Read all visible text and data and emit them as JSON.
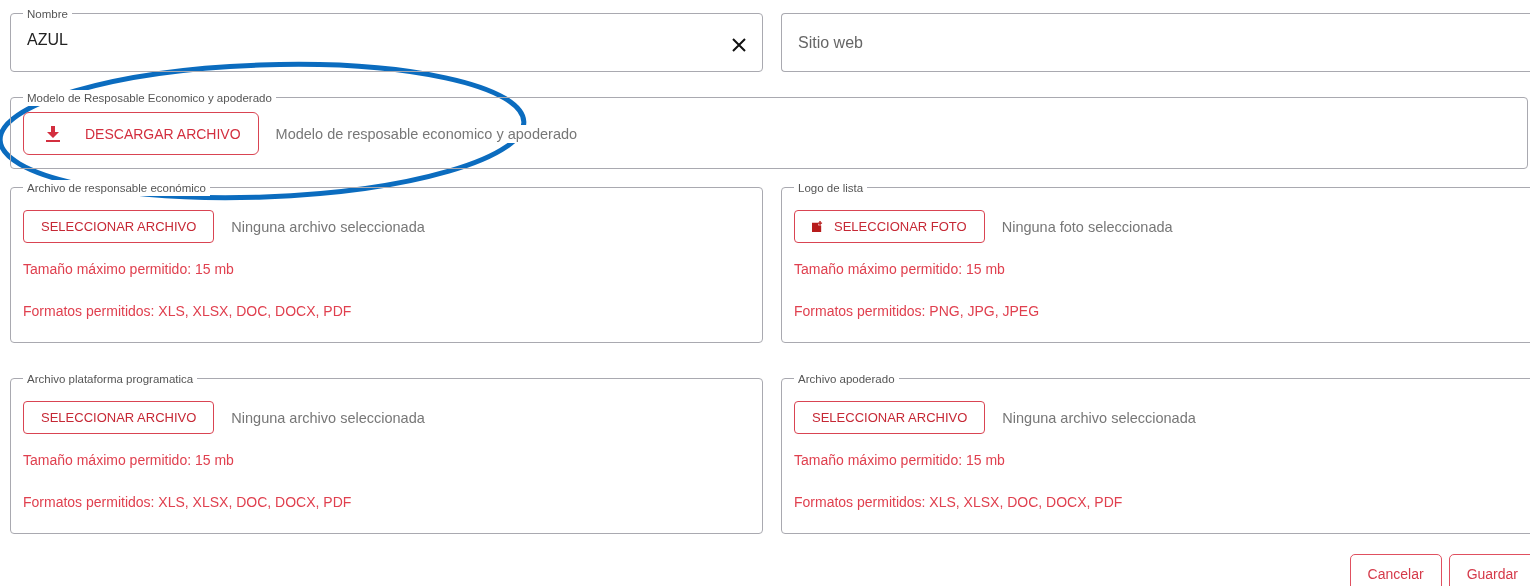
{
  "fields": [
    {
      "label": "Nombre",
      "value": "AZUL",
      "clearable": true
    },
    {
      "placeholder": "Sitio web",
      "clearable": false
    }
  ],
  "download": {
    "legend": "Modelo de Resposable Economico y apoderado",
    "button": "DESCARGAR ARCHIVO",
    "description": "Modelo de resposable economico y apoderado"
  },
  "uploads": [
    {
      "legend": "Archivo de responsable económico",
      "kind": "file",
      "button": "SELECCIONAR ARCHIVO",
      "status": "Ninguna archivo seleccionada",
      "max_size": "Tamaño máximo permitido: 15 mb",
      "formats": "Formatos permitidos: XLS, XLSX, DOC, DOCX, PDF"
    },
    {
      "legend": "Logo de lista",
      "kind": "photo",
      "button": "SELECCIONAR FOTO",
      "status": "Ninguna foto seleccionada",
      "max_size": "Tamaño máximo permitido: 15 mb",
      "formats": "Formatos permitidos: PNG, JPG, JPEG"
    },
    {
      "legend": "Archivo plataforma programatica",
      "kind": "file",
      "button": "SELECCIONAR ARCHIVO",
      "status": "Ninguna archivo seleccionada",
      "max_size": "Tamaño máximo permitido: 15 mb",
      "formats": "Formatos permitidos: XLS, XLSX, DOC, DOCX, PDF"
    },
    {
      "legend": "Archivo apoderado",
      "kind": "file",
      "button": "SELECCIONAR ARCHIVO",
      "status": "Ninguna archivo seleccionada",
      "max_size": "Tamaño máximo permitido: 15 mb",
      "formats": "Formatos permitidos: XLS, XLSX, DOC, DOCX, PDF"
    }
  ],
  "actions": [
    "Cancelar",
    "Guardar"
  ]
}
